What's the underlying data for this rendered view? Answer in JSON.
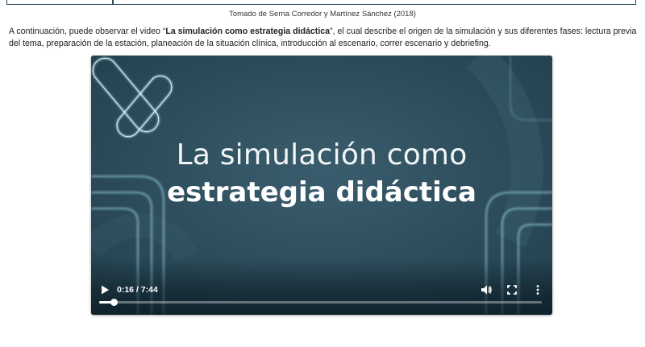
{
  "caption": "Tomado de Serna Corredor y Martínez Sánchez (2018)",
  "intro": {
    "before": "A continuación, puede observar el video “",
    "bold": "La simulación como estrategia didáctica",
    "after": "”, el cual describe el origen de la simulación y sus diferentes fases: lectura previa del tema, preparación de la estación, planeación de la situación clínica, introducción al escenario, correr escenario y debriefing."
  },
  "video": {
    "title_line1": "La simulación como",
    "title_line2": "estrategia didáctica",
    "time_display": "0:16 / 7:44",
    "current_seconds": 16,
    "duration_seconds": 464,
    "background_color": "#2c4c5c",
    "controls": {
      "play_icon": "play-icon",
      "volume_icon": "volume-icon",
      "fullscreen_icon": "fullscreen-icon",
      "more_icon": "more-options-icon"
    }
  }
}
